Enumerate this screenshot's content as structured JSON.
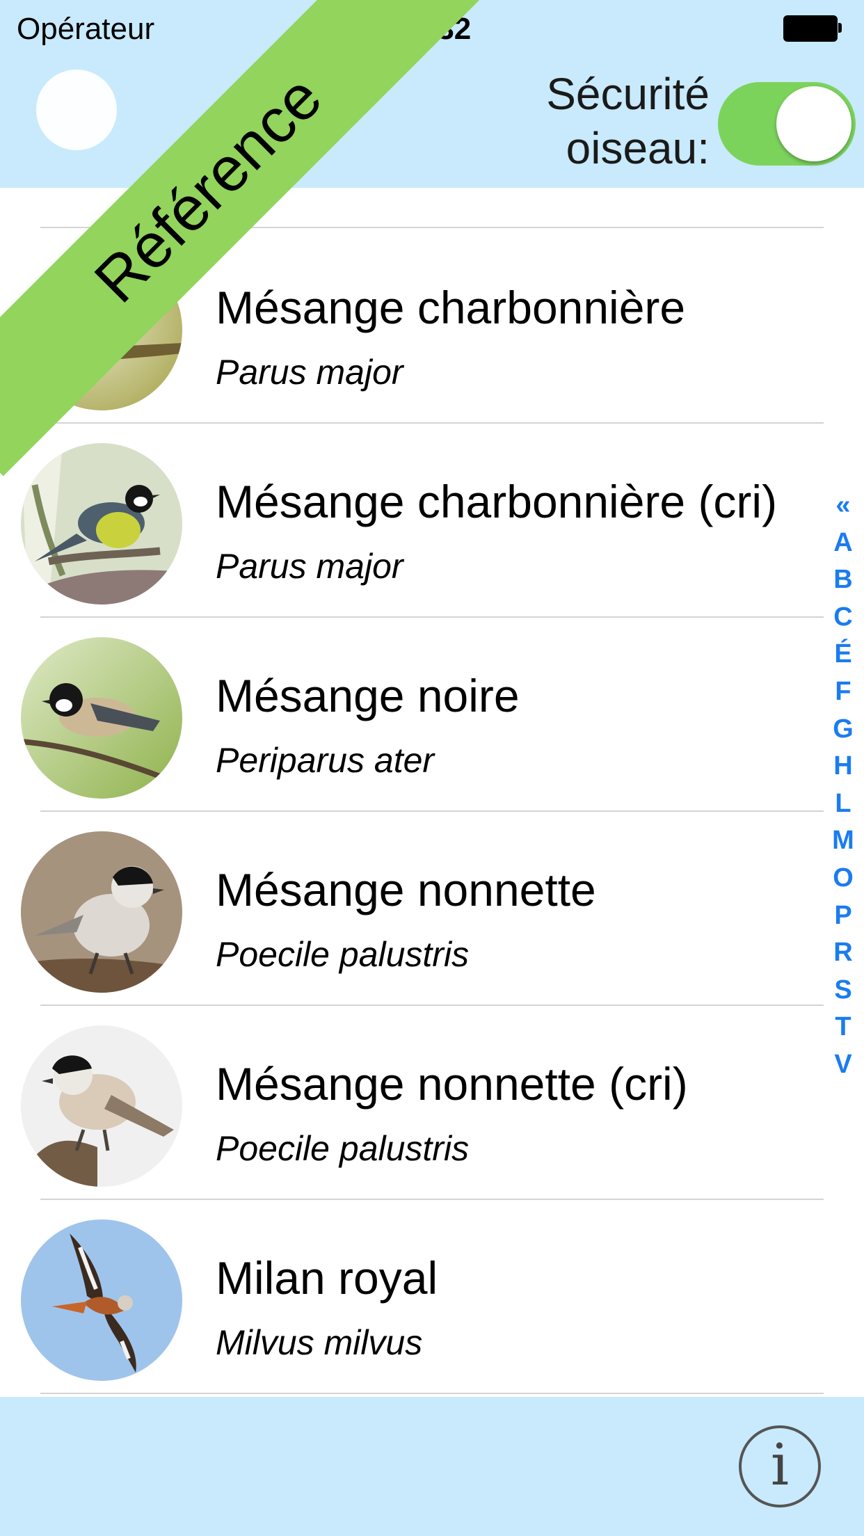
{
  "status_bar": {
    "carrier": "Opérateur",
    "time": "09:32"
  },
  "header": {
    "safety_label": "Sécurité oiseau:",
    "safety_toggle_on": true,
    "accent_color": "#7cd35c",
    "band_color": "#c8eafc"
  },
  "ribbon": {
    "label": "Référence",
    "color": "#92d45c"
  },
  "birds": [
    {
      "common": "Mésange charbonnière",
      "latin": "Parus major"
    },
    {
      "common": "Mésange charbonnière (cri)",
      "latin": "Parus major"
    },
    {
      "common": "Mésange noire",
      "latin": "Periparus ater"
    },
    {
      "common": "Mésange nonnette",
      "latin": "Poecile palustris"
    },
    {
      "common": "Mésange nonnette (cri)",
      "latin": "Poecile palustris"
    },
    {
      "common": "Milan royal",
      "latin": "Milvus milvus"
    }
  ],
  "index": [
    "«",
    "A",
    "B",
    "C",
    "É",
    "F",
    "G",
    "H",
    "L",
    "M",
    "O",
    "P",
    "R",
    "S",
    "T",
    "V"
  ],
  "index_color": "#1a7cf0",
  "footer": {
    "info_label": "i",
    "info_icon": "info-icon"
  }
}
